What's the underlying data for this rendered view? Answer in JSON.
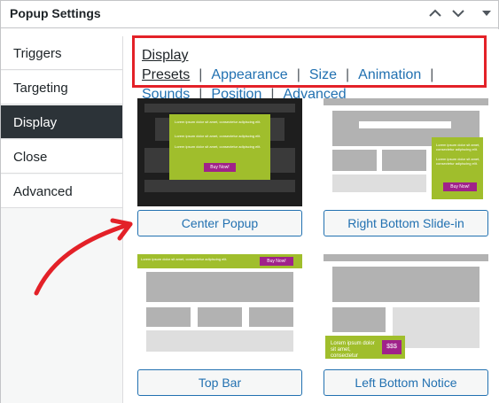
{
  "header": {
    "title": "Popup Settings"
  },
  "tabs": [
    {
      "label": "Triggers"
    },
    {
      "label": "Targeting"
    },
    {
      "label": "Display"
    },
    {
      "label": "Close"
    },
    {
      "label": "Advanced"
    }
  ],
  "subnav": {
    "items": [
      {
        "label": "Display Presets"
      },
      {
        "label": "Appearance"
      },
      {
        "label": "Size"
      },
      {
        "label": "Animation"
      },
      {
        "label": "Sounds"
      },
      {
        "label": "Position"
      },
      {
        "label": "Advanced"
      }
    ],
    "separator": "|"
  },
  "presets": [
    {
      "label": "Center Popup"
    },
    {
      "label": "Right Bottom Slide-in"
    },
    {
      "label": "Top Bar"
    },
    {
      "label": "Left Bottom Notice"
    }
  ],
  "thumbs": {
    "lorem": "Lorem ipsum dolor sit amet, consectetur adipiscing elit.",
    "lorem_short": "Lorem ipsum dolor sit amet, consectetur",
    "buy_now": "Buy Now!",
    "price": "$$$"
  },
  "colors": {
    "accent_red": "#e32128",
    "link_blue": "#2271b1",
    "active_tab": "#2c3338",
    "popup_green": "#a0be2c",
    "buy_purple": "#a0228a"
  }
}
